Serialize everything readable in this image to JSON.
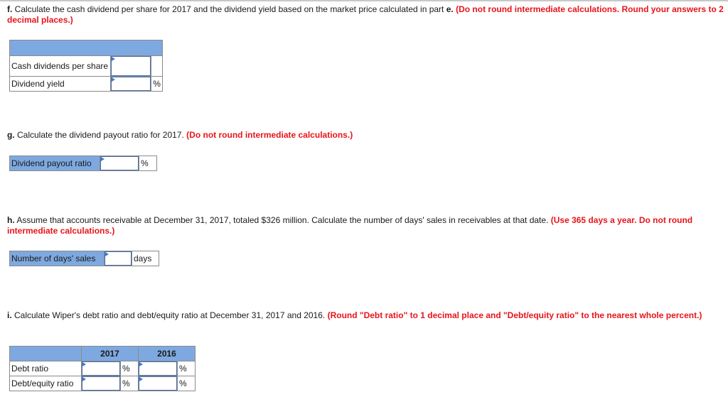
{
  "part_f": {
    "letter": "f.",
    "text": " Calculate the cash dividend per share for 2017 and the dividend yield based on the market price calculated in part ",
    "part_ref": "e.",
    "instruction": " (Do not round intermediate calculations. Round your answers to 2 decimal places.)",
    "rows": [
      {
        "label": "Cash dividends per share",
        "value": "",
        "unit": ""
      },
      {
        "label": "Dividend yield",
        "value": "",
        "unit": "%"
      }
    ]
  },
  "part_g": {
    "letter": "g.",
    "text": " Calculate the dividend payout ratio for 2017. ",
    "instruction": "(Do not round intermediate calculations.)",
    "row": {
      "label": "Dividend payout ratio",
      "value": "",
      "unit": "%"
    }
  },
  "part_h": {
    "letter": "h.",
    "text": " Assume that accounts receivable at December 31, 2017, totaled $326 million. Calculate the number of days' sales in receivables at that date. ",
    "instruction": "(Use 365 days a year. Do not round intermediate calculations.)",
    "row": {
      "label": "Number of days' sales",
      "value": "",
      "unit": "days"
    }
  },
  "part_i": {
    "letter": "i.",
    "text": " Calculate Wiper's debt ratio and debt/equity ratio at December 31, 2017 and 2016. ",
    "instruction": "(Round \"Debt ratio\" to 1 decimal place and \"Debt/equity ratio\" to the nearest whole percent.)",
    "columns": [
      "2017",
      "2016"
    ],
    "rows": [
      {
        "label": "Debt ratio",
        "values": [
          "",
          ""
        ],
        "unit": "%"
      },
      {
        "label": "Debt/equity ratio",
        "values": [
          "",
          ""
        ],
        "unit": "%"
      }
    ]
  }
}
